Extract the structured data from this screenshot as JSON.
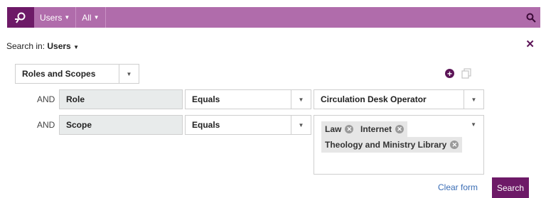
{
  "topbar": {
    "scope_label": "Users",
    "filter_label": "All"
  },
  "search_in": {
    "prefix": "Search in:",
    "value": "Users"
  },
  "criteria_type": "Roles and Scopes",
  "rows": [
    {
      "conjunction": "AND",
      "field": "Role",
      "operator": "Equals",
      "value": "Circulation Desk Operator"
    },
    {
      "conjunction": "AND",
      "field": "Scope",
      "operator": "Equals",
      "tags": [
        "Law",
        "Internet",
        "Theology and Ministry Library"
      ]
    }
  ],
  "actions": {
    "clear_label": "Clear form",
    "search_label": "Search"
  },
  "colors": {
    "brand_dark": "#6d1a67",
    "brand_light": "#b06cab",
    "link": "#3a6db5"
  },
  "icons": {
    "logo": "primo-logo-icon",
    "search": "search-icon",
    "close": "close-icon",
    "add": "add-circle-icon",
    "copy": "copy-icon"
  }
}
